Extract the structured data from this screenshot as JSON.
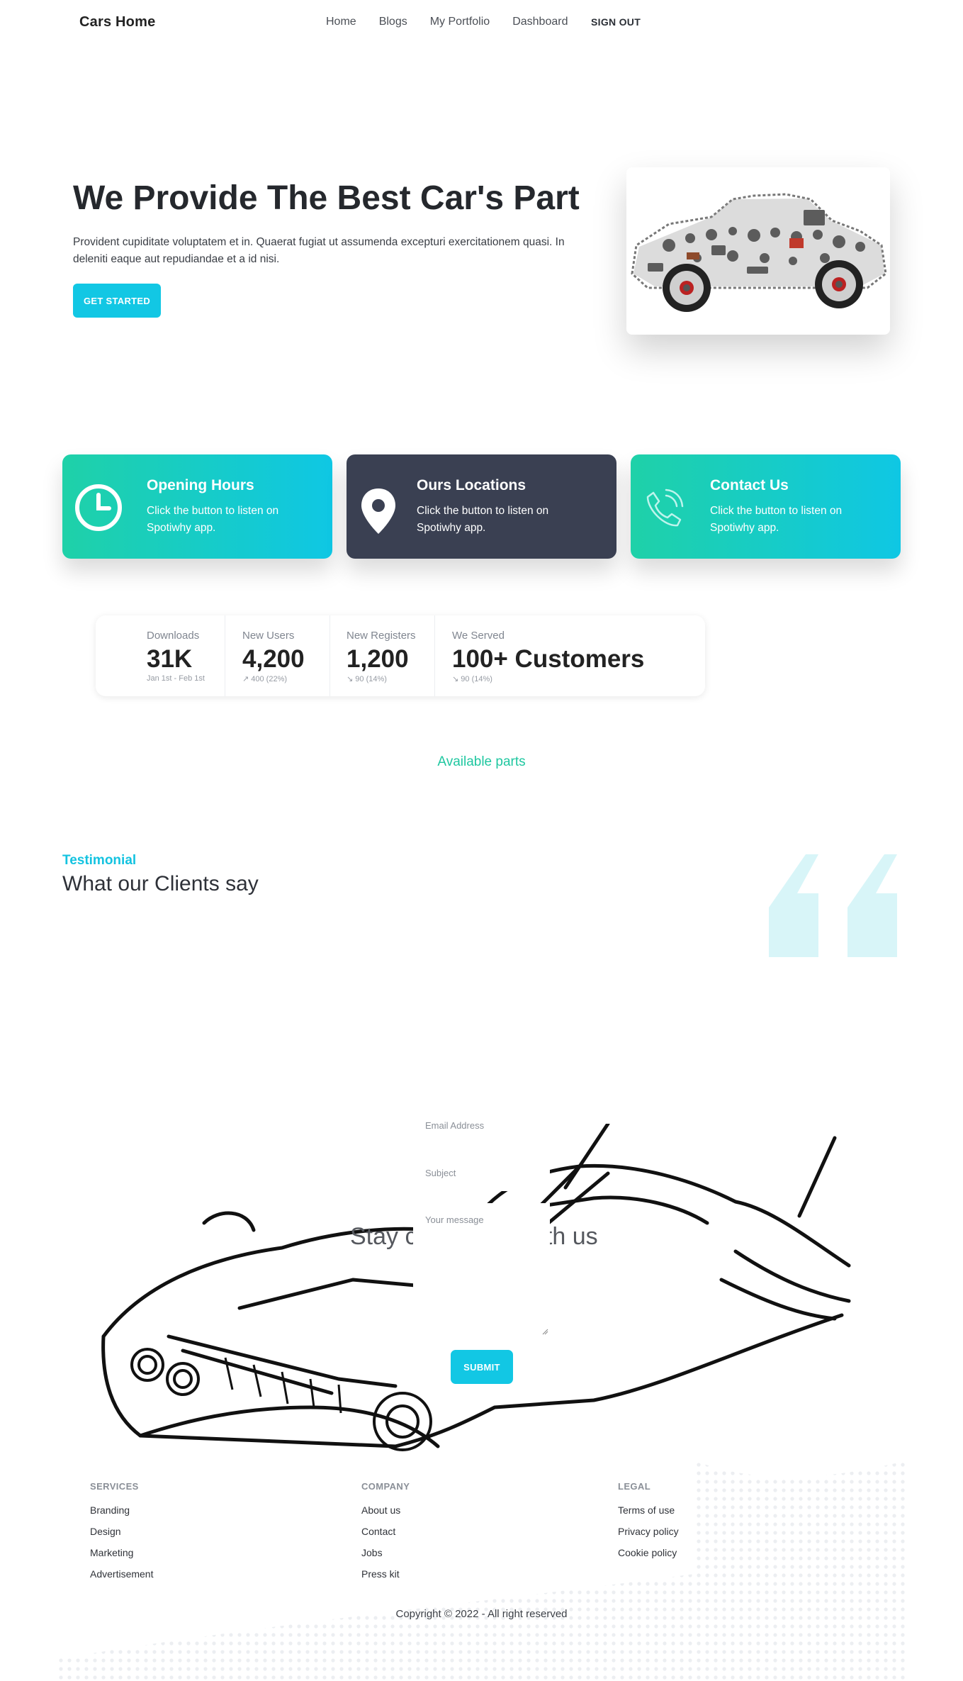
{
  "nav": {
    "brand": "Cars Home",
    "links": [
      "Home",
      "Blogs",
      "My Portfolio",
      "Dashboard"
    ],
    "signout": "SIGN OUT"
  },
  "hero": {
    "title": "We Provide The Best Car's Part",
    "text": "Provident cupiditate voluptatem et in. Quaerat fugiat ut assumenda excepturi exercitationem quasi. In deleniti eaque aut repudiandae et a id nisi.",
    "button": "GET STARTED"
  },
  "cards": [
    {
      "title": "Opening Hours",
      "text": "Click the button to listen on Spotiwhy app.",
      "icon": "clock-icon"
    },
    {
      "title": "Ours Locations",
      "text": "Click the button to listen on Spotiwhy app.",
      "icon": "map-pin-icon"
    },
    {
      "title": "Contact Us",
      "text": "Click the button to listen on Spotiwhy app.",
      "icon": "phone-icon"
    }
  ],
  "stats": [
    {
      "label": "Downloads",
      "value": "31K",
      "sub": "Jan 1st - Feb 1st"
    },
    {
      "label": "New Users",
      "value": "4,200",
      "sub": "↗ 400 (22%)"
    },
    {
      "label": "New Registers",
      "value": "1,200",
      "sub": "↘ 90 (14%)"
    },
    {
      "label": "We Served",
      "value": "100+ Customers",
      "sub": "↘ 90 (14%)"
    }
  ],
  "available": "Available parts",
  "testimonial": {
    "eyebrow": "Testimonial",
    "title": "What our Clients say"
  },
  "contact": {
    "heading": "Stay connected with us",
    "email_label": "Email Address",
    "subject_label": "Subject",
    "message_label": "Your message",
    "submit": "SUBMIT"
  },
  "footer": {
    "columns": [
      {
        "heading": "SERVICES",
        "links": [
          "Branding",
          "Design",
          "Marketing",
          "Advertisement"
        ]
      },
      {
        "heading": "COMPANY",
        "links": [
          "About us",
          "Contact",
          "Jobs",
          "Press kit"
        ]
      },
      {
        "heading": "LEGAL",
        "links": [
          "Terms of use",
          "Privacy policy",
          "Cookie policy"
        ]
      }
    ],
    "copyright": "Copyright © 2022 - All right reserved"
  },
  "colors": {
    "accent": "#12c7e4",
    "teal": "#1fd1a8",
    "dark_card": "#3a4052",
    "quote": "#d8f5f8"
  }
}
